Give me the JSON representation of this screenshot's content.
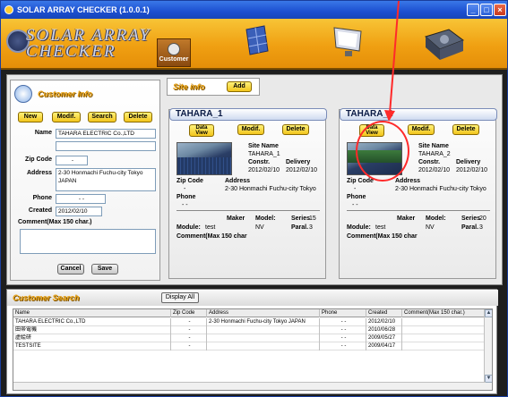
{
  "window": {
    "title": "SOLAR ARRAY CHECKER (1.0.0.1)"
  },
  "logo": {
    "line1": "SOLAR ARRAY",
    "line2": "CHECKER"
  },
  "nav": {
    "customer_label": "Customer"
  },
  "customer": {
    "header": "Customer Info",
    "buttons": {
      "new": "New",
      "modif": "Modif.",
      "search": "Search",
      "delete": "Delete",
      "cancel": "Cancel",
      "save": "Save"
    },
    "labels": {
      "name": "Name",
      "zip": "Zip Code",
      "address": "Address",
      "phone": "Phone",
      "created": "Created",
      "comment": "Comment(Max 150 char.)"
    },
    "values": {
      "name": "TAHARA ELECTRIC Co.,LTD",
      "name2": "",
      "zip": "-",
      "address": "2-30 Honmachi Fuchu-city Tokyo JAPAN",
      "phone": "-  -",
      "created": "2012/02/10",
      "comment": ""
    }
  },
  "siteinfo": {
    "header": "Site info",
    "add": "Add"
  },
  "sites": [
    {
      "title": "TAHARA_1",
      "dataview": "Data View",
      "modif": "Modif.",
      "delete": "Delete",
      "sitename_label": "Site Name",
      "sitename": "TAHARA_1",
      "constr_label": "Constr.",
      "delivery_label": "Delivery",
      "constr": "2012/02/10",
      "delivery": "2012/02/10",
      "zip_label": "Zip Code",
      "zip": "-",
      "address_label": "Address",
      "address": "2-30 Honmachi Fuchu-city Tokyo",
      "phone_label": "Phone",
      "phone": "-  -",
      "maker_label": "Maker",
      "model_label": "Model:",
      "series_label": "Series",
      "series": "15",
      "module_label": "Module:",
      "module": "test",
      "model": "NV",
      "paral_label": "Paral.",
      "paral": "3",
      "comment_label": "Comment(Max 150 char"
    },
    {
      "title": "TAHARA_2",
      "dataview": "Data View",
      "modif": "Modif.",
      "delete": "Delete",
      "sitename_label": "Site Name",
      "sitename": "TAHARA_2",
      "constr_label": "Constr.",
      "delivery_label": "Delivery",
      "constr": "2012/02/10",
      "delivery": "2012/02/10",
      "zip_label": "Zip Code",
      "zip": "-",
      "address_label": "Address",
      "address": "2-30 Honmachi Fuchu-city Tokyo",
      "phone_label": "Phone",
      "phone": "-  -",
      "maker_label": "Maker",
      "model_label": "Model:",
      "series_label": "Series",
      "series": "20",
      "module_label": "Module:",
      "module": "test",
      "model": "NV",
      "paral_label": "Paral.",
      "paral": "3",
      "comment_label": "Comment(Max 150 char"
    }
  ],
  "search": {
    "header": "Customer Search",
    "display_all": "Display All",
    "columns": [
      "Name",
      "Zip Code",
      "Address",
      "Phone",
      "Created",
      "Comment(Max 150 char.)"
    ],
    "rows": [
      [
        "TAHARA ELECTRIC Co.,LTD",
        "-",
        "2-30 Honmachi Fuchu-city Tokyo JAPAN",
        "-  -",
        "2012/02/10",
        ""
      ],
      [
        "田帯電機",
        "-",
        "",
        "-  -",
        "2010/06/28",
        ""
      ],
      [
        "虚絵研",
        "-",
        "",
        "-  -",
        "2009/05/27",
        ""
      ],
      [
        "TESTSITE",
        "-",
        "",
        "-  -",
        "2009/04/17",
        ""
      ]
    ]
  },
  "colors": {
    "titlebar": "#1c4fd0",
    "banner": "#f0a012",
    "annotation": "#ff2a2a"
  }
}
